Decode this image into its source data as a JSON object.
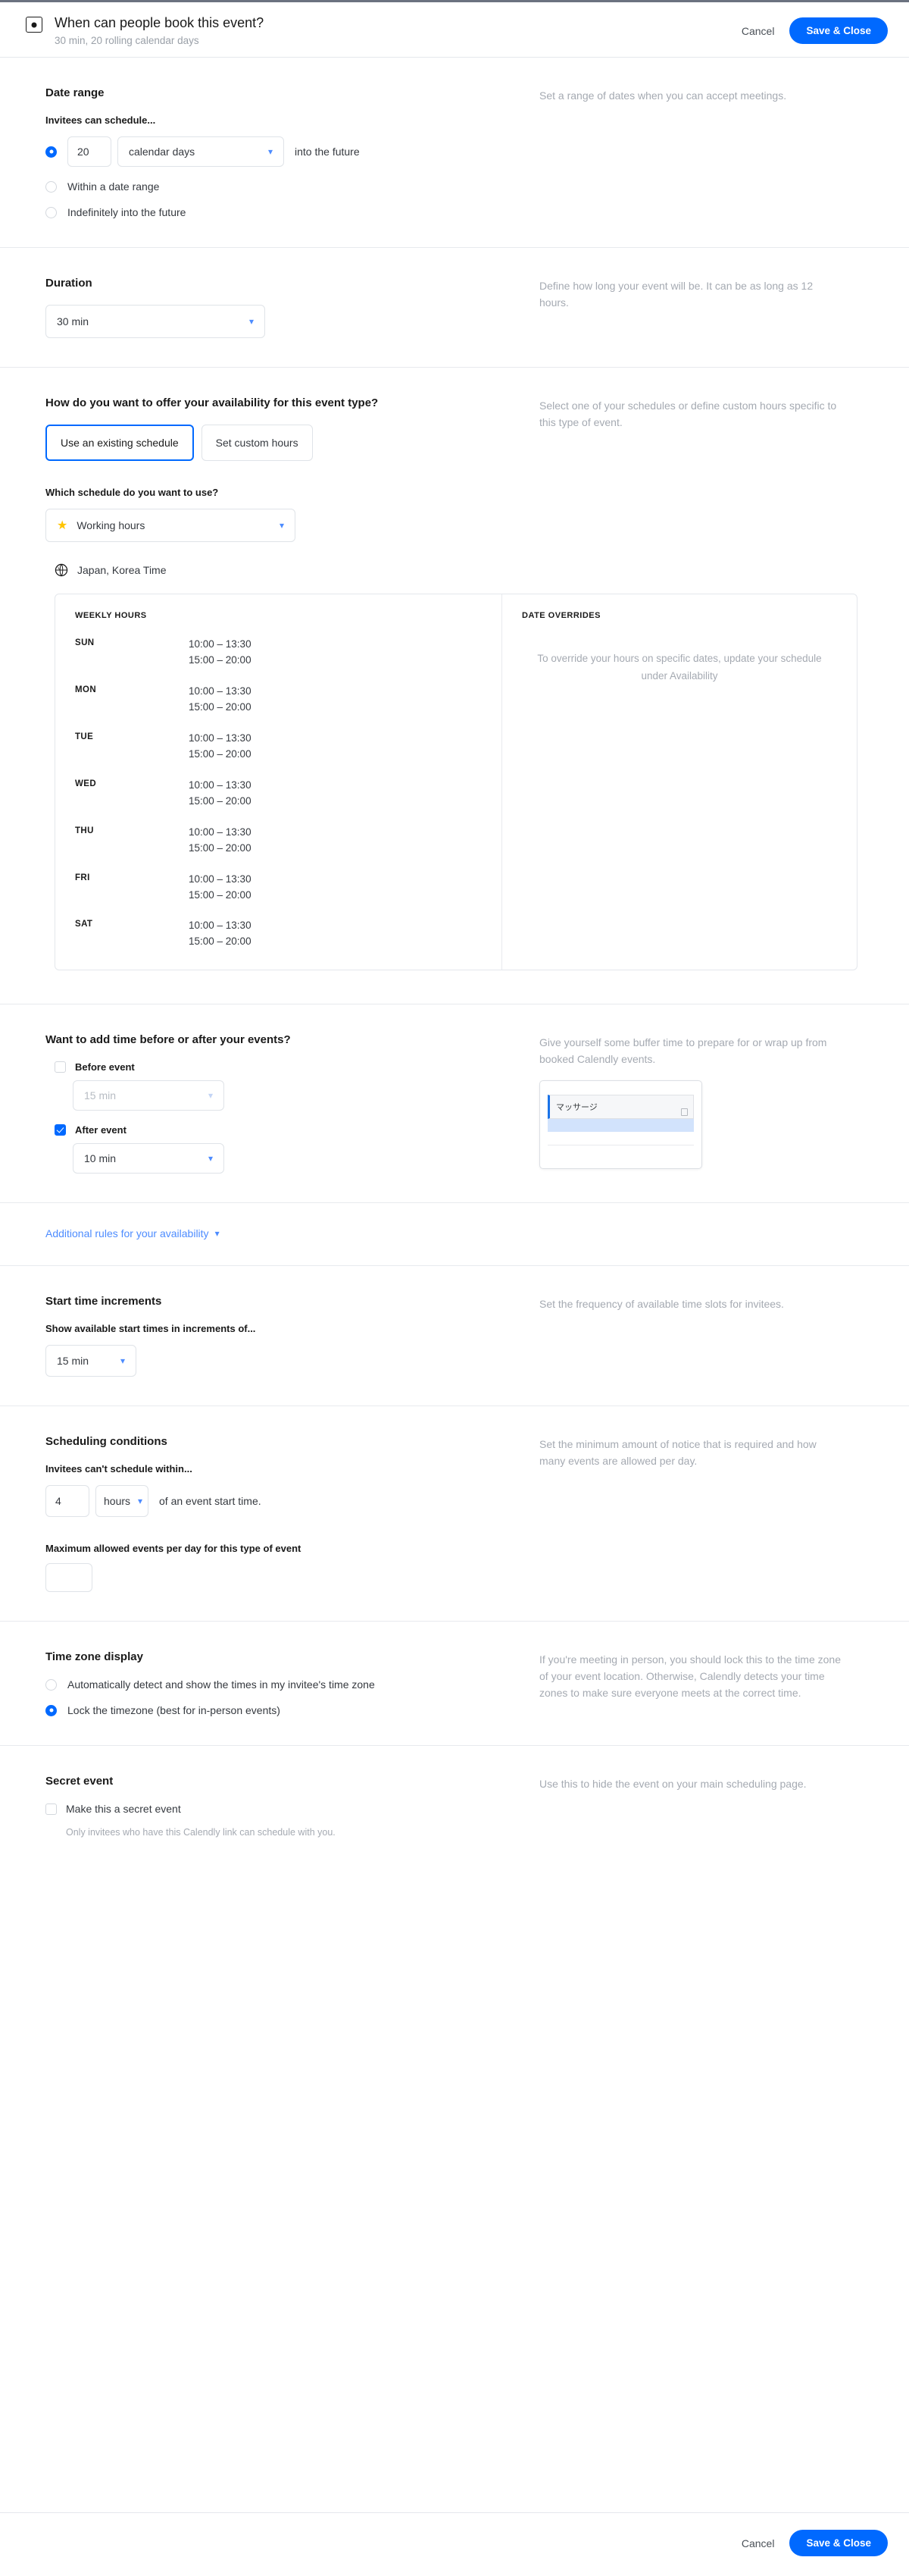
{
  "header": {
    "icon": "calendar-event-icon",
    "title": "When can people book this event?",
    "subtitle": "30 min, 20 rolling calendar days",
    "cancel_label": "Cancel",
    "save_label": "Save & Close"
  },
  "date_range": {
    "title": "Date range",
    "sub_label": "Invitees can schedule...",
    "rolling_value": "20",
    "rolling_unit": "calendar days",
    "rolling_suffix": "into the future",
    "option_within": "Within a date range",
    "option_indefinitely": "Indefinitely into the future",
    "selected": "rolling",
    "hint": "Set a range of dates when you can accept meetings."
  },
  "duration": {
    "title": "Duration",
    "value": "30 min",
    "hint": "Define how long your event will be. It can be as long as 12 hours."
  },
  "availability": {
    "title": "How do you want to offer your availability for this event type?",
    "toggle_existing": "Use an existing schedule",
    "toggle_custom": "Set custom hours",
    "selected_toggle": "existing",
    "which_schedule_label": "Which schedule do you want to use?",
    "schedule_name": "Working hours",
    "schedule_star_icon": "star-icon",
    "timezone_icon": "globe-icon",
    "timezone": "Japan, Korea Time",
    "hint": "Select one of your schedules or define custom hours specific to this type of event.",
    "weekly_hours_heading": "WEEKLY HOURS",
    "date_overrides_heading": "DATE OVERRIDES",
    "date_overrides_message": "To override your hours on specific dates, update your schedule under Availability",
    "days": [
      {
        "name": "SUN",
        "slot1": "10:00 – 13:30",
        "slot2": "15:00 – 20:00"
      },
      {
        "name": "MON",
        "slot1": "10:00 – 13:30",
        "slot2": "15:00 – 20:00"
      },
      {
        "name": "TUE",
        "slot1": "10:00 – 13:30",
        "slot2": "15:00 – 20:00"
      },
      {
        "name": "WED",
        "slot1": "10:00 – 13:30",
        "slot2": "15:00 – 20:00"
      },
      {
        "name": "THU",
        "slot1": "10:00 – 13:30",
        "slot2": "15:00 – 20:00"
      },
      {
        "name": "FRI",
        "slot1": "10:00 – 13:30",
        "slot2": "15:00 – 20:00"
      },
      {
        "name": "SAT",
        "slot1": "10:00 – 13:30",
        "slot2": "15:00 – 20:00"
      }
    ]
  },
  "buffer": {
    "title": "Want to add time before or after your events?",
    "before_label": "Before event",
    "before_checked": false,
    "before_value": "15 min",
    "after_label": "After event",
    "after_checked": true,
    "after_value": "10 min",
    "hint": "Give yourself some buffer time to prepare for or wrap up from booked Calendly events.",
    "ime_popup_text": "マッサージ",
    "ime_copy_icon": "copy-icon"
  },
  "additional_rules": {
    "label": "Additional rules for your availability",
    "chevron_icon": "chevron-down-icon"
  },
  "start_increments": {
    "title": "Start time increments",
    "sub_label": "Show available start times in increments of...",
    "value": "15 min",
    "hint": "Set the frequency of available time slots for invitees."
  },
  "scheduling_conditions": {
    "title": "Scheduling conditions",
    "sub_label": "Invitees can't schedule within...",
    "notice_value": "4",
    "notice_unit": "hours",
    "notice_suffix": "of an event start time.",
    "max_events_label": "Maximum allowed events per day for this type of event",
    "max_events_value": "",
    "hint": "Set the minimum amount of notice that is required and how many events are allowed per day."
  },
  "timezone_display": {
    "title": "Time zone display",
    "option_auto": "Automatically detect and show the times in my invitee's time zone",
    "option_lock": "Lock the timezone (best for in-person events)",
    "selected": "lock",
    "hint": "If you're meeting in person, you should lock this to the time zone of your event location. Otherwise, Calendly detects your time zones to make sure everyone meets at the correct time."
  },
  "secret_event": {
    "title": "Secret event",
    "checkbox_label": "Make this a secret event",
    "checked": false,
    "note": "Only invitees who have this Calendly link can schedule with you.",
    "hint": "Use this to hide the event on your main scheduling page."
  },
  "footer": {
    "cancel_label": "Cancel",
    "save_label": "Save & Close"
  },
  "colors": {
    "accent": "#0069ff",
    "star": "#ffc400",
    "link": "#4d8cff",
    "ime_highlight": "#d2e3fc"
  }
}
